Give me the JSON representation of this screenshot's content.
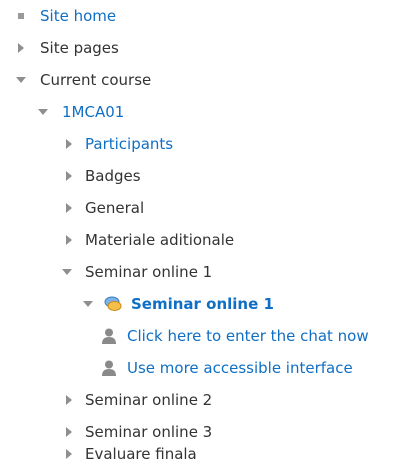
{
  "tree": {
    "site_home": "Site home",
    "site_pages": "Site pages",
    "current_course": "Current course",
    "course_code": "1MCA01",
    "participants": "Participants",
    "badges": "Badges",
    "general": "General",
    "materiale": "Materiale aditionale",
    "seminar1": "Seminar online 1",
    "seminar1_chat": "Seminar online 1",
    "enter_chat": "Click here to enter the chat now",
    "accessible": "Use more accessible interface",
    "seminar2": "Seminar online 2",
    "seminar3": "Seminar online 3",
    "evaluare": "Evaluare finala"
  },
  "icons": {
    "bullet": "square-bullet-icon",
    "collapsed": "caret-right-icon",
    "expanded": "caret-down-icon",
    "chat": "chat-bubbles-icon",
    "person": "person-icon"
  },
  "colors": {
    "link": "#0f6fc5",
    "text": "#333333",
    "marker": "#8f8f8f"
  }
}
